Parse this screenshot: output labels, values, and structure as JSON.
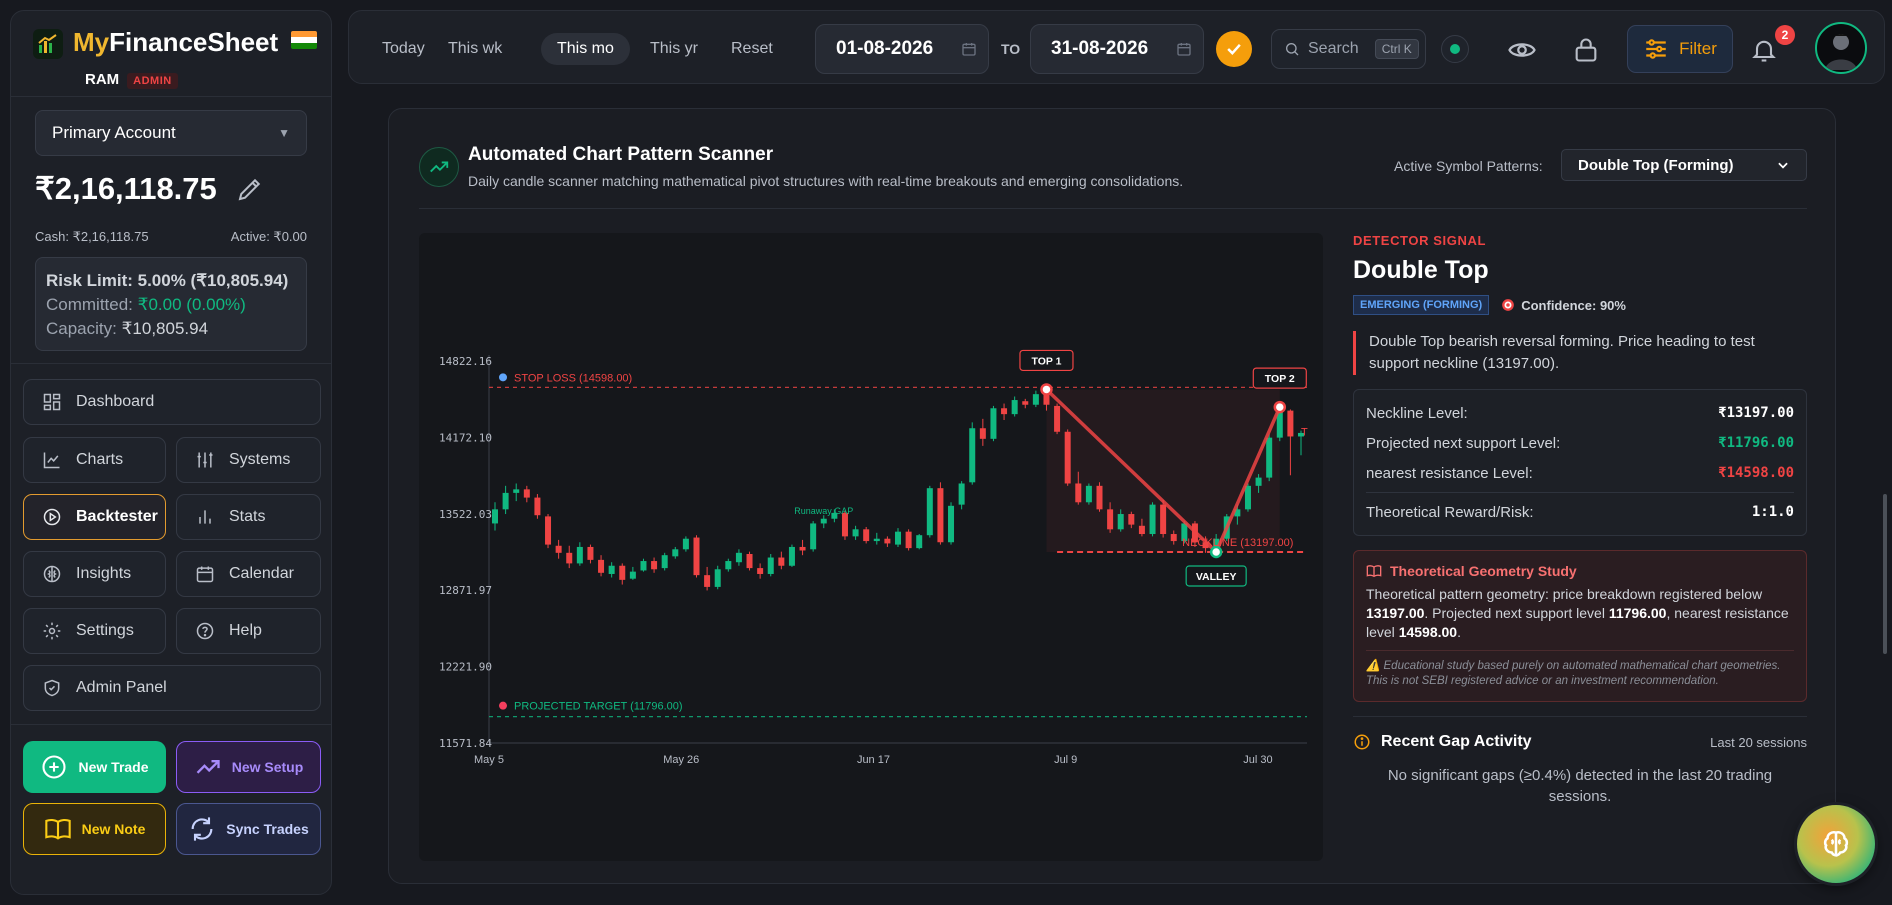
{
  "brand": {
    "name_part1": "My",
    "name_part2": "FinanceSheet",
    "user": "RAM",
    "role": "ADMIN"
  },
  "account": {
    "selected": "Primary Account",
    "balance": "₹2,16,118.75",
    "cash": "Cash: ₹2,16,118.75",
    "active": "Active: ₹0.00",
    "risk_limit": "Risk Limit: 5.00% (₹10,805.94)",
    "committed_label": "Committed:",
    "committed_value": "₹0.00 (0.00%)",
    "capacity_label": "Capacity:",
    "capacity_value": "₹10,805.94"
  },
  "nav": {
    "dashboard": "Dashboard",
    "charts": "Charts",
    "systems": "Systems",
    "backtester": "Backtester",
    "stats": "Stats",
    "insights": "Insights",
    "calendar": "Calendar",
    "settings": "Settings",
    "help": "Help",
    "admin_panel": "Admin Panel"
  },
  "actions": {
    "new_trade": "New Trade",
    "new_setup": "New Setup",
    "new_note": "New Note",
    "sync_trades": "Sync Trades"
  },
  "topbar": {
    "periods": [
      "Today",
      "This wk",
      "This mo",
      "This yr",
      "Reset"
    ],
    "active_period": "This mo",
    "date_from": "01-08-2026",
    "to_label": "TO",
    "date_to": "31-08-2026",
    "search_placeholder": "Search",
    "search_shortcut": "Ctrl K",
    "filter": "Filter",
    "notification_count": "2"
  },
  "scanner": {
    "title": "Automated Chart Pattern Scanner",
    "subtitle": "Daily candle scanner matching mathematical pivot structures with real-time breakouts and emerging consolidations.",
    "pattern_label": "Active Symbol Patterns:",
    "pattern_selected": "Double Top (Forming)"
  },
  "chart_data": {
    "type": "candlestick",
    "y_ticks": [
      "14822.16",
      "14172.10",
      "13522.03",
      "12871.97",
      "12221.90",
      "11571.84"
    ],
    "ylim": [
      11571.84,
      14822.16
    ],
    "x_ticks": [
      "May 5",
      "May 26",
      "Jun 17",
      "Jul 9",
      "Jul 30"
    ],
    "levels": {
      "stop_loss": 14598.0,
      "neckline": 13197.0,
      "projected_target": 11796.0
    },
    "labels": {
      "stop_loss": "STOP LOSS (14598.00)",
      "neckline": "NECKLINE (13197.00)",
      "target": "PROJECTED TARGET (11796.00)",
      "top1": "TOP 1",
      "top2": "TOP 2",
      "valley": "VALLEY",
      "runaway": "Runaway GAP",
      "t_marker": "T"
    },
    "candles": [
      {
        "o": 13440,
        "h": 13620,
        "l": 13380,
        "c": 13560
      },
      {
        "o": 13560,
        "h": 13760,
        "l": 13520,
        "c": 13700
      },
      {
        "o": 13700,
        "h": 13780,
        "l": 13630,
        "c": 13730
      },
      {
        "o": 13730,
        "h": 13760,
        "l": 13620,
        "c": 13660
      },
      {
        "o": 13660,
        "h": 13690,
        "l": 13480,
        "c": 13510
      },
      {
        "o": 13500,
        "h": 13520,
        "l": 13230,
        "c": 13260
      },
      {
        "o": 13250,
        "h": 13300,
        "l": 13140,
        "c": 13190
      },
      {
        "o": 13190,
        "h": 13250,
        "l": 13060,
        "c": 13100
      },
      {
        "o": 13100,
        "h": 13280,
        "l": 13080,
        "c": 13240
      },
      {
        "o": 13240,
        "h": 13260,
        "l": 13100,
        "c": 13130
      },
      {
        "o": 13130,
        "h": 13170,
        "l": 12990,
        "c": 13020
      },
      {
        "o": 13010,
        "h": 13110,
        "l": 12980,
        "c": 13080
      },
      {
        "o": 13080,
        "h": 13100,
        "l": 12920,
        "c": 12960
      },
      {
        "o": 12970,
        "h": 13070,
        "l": 12960,
        "c": 13030
      },
      {
        "o": 13040,
        "h": 13140,
        "l": 13030,
        "c": 13120
      },
      {
        "o": 13120,
        "h": 13150,
        "l": 13020,
        "c": 13050
      },
      {
        "o": 13060,
        "h": 13190,
        "l": 13040,
        "c": 13170
      },
      {
        "o": 13160,
        "h": 13240,
        "l": 13140,
        "c": 13220
      },
      {
        "o": 13220,
        "h": 13330,
        "l": 13200,
        "c": 13310
      },
      {
        "o": 13320,
        "h": 13340,
        "l": 12980,
        "c": 13000
      },
      {
        "o": 13000,
        "h": 13070,
        "l": 12870,
        "c": 12900
      },
      {
        "o": 12900,
        "h": 13080,
        "l": 12880,
        "c": 13050
      },
      {
        "o": 13050,
        "h": 13140,
        "l": 13030,
        "c": 13120
      },
      {
        "o": 13110,
        "h": 13220,
        "l": 13080,
        "c": 13190
      },
      {
        "o": 13180,
        "h": 13200,
        "l": 13040,
        "c": 13060
      },
      {
        "o": 13060,
        "h": 13100,
        "l": 12970,
        "c": 13010
      },
      {
        "o": 13010,
        "h": 13180,
        "l": 12990,
        "c": 13150
      },
      {
        "o": 13150,
        "h": 13200,
        "l": 13050,
        "c": 13080
      },
      {
        "o": 13080,
        "h": 13260,
        "l": 13070,
        "c": 13240
      },
      {
        "o": 13240,
        "h": 13300,
        "l": 13170,
        "c": 13210
      },
      {
        "o": 13220,
        "h": 13460,
        "l": 13200,
        "c": 13440
      },
      {
        "o": 13440,
        "h": 13510,
        "l": 13400,
        "c": 13480
      },
      {
        "o": 13480,
        "h": 13560,
        "l": 13450,
        "c": 13530
      },
      {
        "o": 13530,
        "h": 13550,
        "l": 13300,
        "c": 13330
      },
      {
        "o": 13330,
        "h": 13420,
        "l": 13300,
        "c": 13390
      },
      {
        "o": 13390,
        "h": 13410,
        "l": 13270,
        "c": 13290
      },
      {
        "o": 13290,
        "h": 13360,
        "l": 13260,
        "c": 13310
      },
      {
        "o": 13310,
        "h": 13330,
        "l": 13240,
        "c": 13270
      },
      {
        "o": 13260,
        "h": 13400,
        "l": 13240,
        "c": 13370
      },
      {
        "o": 13370,
        "h": 13390,
        "l": 13210,
        "c": 13230
      },
      {
        "o": 13230,
        "h": 13350,
        "l": 13220,
        "c": 13340
      },
      {
        "o": 13340,
        "h": 13760,
        "l": 13320,
        "c": 13740
      },
      {
        "o": 13740,
        "h": 13790,
        "l": 13260,
        "c": 13280
      },
      {
        "o": 13280,
        "h": 13620,
        "l": 13260,
        "c": 13590
      },
      {
        "o": 13600,
        "h": 13800,
        "l": 13560,
        "c": 13780
      },
      {
        "o": 13790,
        "h": 14300,
        "l": 13770,
        "c": 14250
      },
      {
        "o": 14250,
        "h": 14330,
        "l": 14100,
        "c": 14160
      },
      {
        "o": 14160,
        "h": 14440,
        "l": 14140,
        "c": 14420
      },
      {
        "o": 14420,
        "h": 14460,
        "l": 14320,
        "c": 14370
      },
      {
        "o": 14370,
        "h": 14520,
        "l": 14350,
        "c": 14490
      },
      {
        "o": 14480,
        "h": 14500,
        "l": 14420,
        "c": 14450
      },
      {
        "o": 14450,
        "h": 14570,
        "l": 14430,
        "c": 14540
      },
      {
        "o": 14540,
        "h": 14580,
        "l": 14400,
        "c": 14450
      },
      {
        "o": 14440,
        "h": 14460,
        "l": 14200,
        "c": 14220
      },
      {
        "o": 14220,
        "h": 14240,
        "l": 13760,
        "c": 13780
      },
      {
        "o": 13780,
        "h": 13880,
        "l": 13600,
        "c": 13620
      },
      {
        "o": 13620,
        "h": 13780,
        "l": 13600,
        "c": 13760
      },
      {
        "o": 13760,
        "h": 13790,
        "l": 13540,
        "c": 13560
      },
      {
        "o": 13560,
        "h": 13620,
        "l": 13360,
        "c": 13390
      },
      {
        "o": 13390,
        "h": 13560,
        "l": 13370,
        "c": 13520
      },
      {
        "o": 13520,
        "h": 13540,
        "l": 13400,
        "c": 13430
      },
      {
        "o": 13420,
        "h": 13480,
        "l": 13330,
        "c": 13350
      },
      {
        "o": 13350,
        "h": 13620,
        "l": 13330,
        "c": 13600
      },
      {
        "o": 13600,
        "h": 13640,
        "l": 13320,
        "c": 13350
      },
      {
        "o": 13350,
        "h": 13380,
        "l": 13260,
        "c": 13290
      },
      {
        "o": 13290,
        "h": 13460,
        "l": 13270,
        "c": 13440
      },
      {
        "o": 13440,
        "h": 13460,
        "l": 13240,
        "c": 13280
      },
      {
        "o": 13280,
        "h": 13330,
        "l": 13190,
        "c": 13230
      },
      {
        "o": 13230,
        "h": 13350,
        "l": 13200,
        "c": 13310
      },
      {
        "o": 13310,
        "h": 13520,
        "l": 13290,
        "c": 13500
      },
      {
        "o": 13500,
        "h": 13600,
        "l": 13430,
        "c": 13560
      },
      {
        "o": 13560,
        "h": 13780,
        "l": 13540,
        "c": 13760
      },
      {
        "o": 13760,
        "h": 13860,
        "l": 13700,
        "c": 13830
      },
      {
        "o": 13830,
        "h": 14200,
        "l": 13800,
        "c": 14170
      },
      {
        "o": 14170,
        "h": 14430,
        "l": 14140,
        "c": 14400
      },
      {
        "o": 14400,
        "h": 14410,
        "l": 13850,
        "c": 14180
      },
      {
        "o": 14180,
        "h": 14230,
        "l": 14020,
        "c": 14210
      }
    ]
  },
  "detector": {
    "label": "DETECTOR SIGNAL",
    "name": "Double Top",
    "status": "EMERGING (FORMING)",
    "confidence": "Confidence: 90%",
    "description": "Double Top bearish reversal forming. Price heading to test support neckline (13197.00).",
    "neckline_label": "Neckline Level:",
    "neckline_value": "₹13197.00",
    "support_label": "Projected next support Level:",
    "support_value": "₹11796.00",
    "resistance_label": "nearest resistance Level:",
    "resistance_value": "₹14598.00",
    "rr_label": "Theoretical Reward/Risk:",
    "rr_value": "1:1.0",
    "colors": {
      "support": "#10b981",
      "resistance": "#ef4444"
    }
  },
  "geometry": {
    "title": "Theoretical Geometry Study",
    "t1": "Theoretical pattern geometry: price breakdown registered below ",
    "v1": "13197.00",
    "t2": ". Projected next support level ",
    "v2": "11796.00",
    "t3": ", nearest resistance level ",
    "v3": "14598.00",
    "t4": ".",
    "note": "⚠️ Educational study based purely on automated mathematical chart geometries. This is not SEBI registered advice or an investment recommendation."
  },
  "gaps": {
    "title": "Recent Gap Activity",
    "range": "Last 20 sessions",
    "message": "No significant gaps (≥0.4%) detected in the last 20 trading sessions."
  }
}
